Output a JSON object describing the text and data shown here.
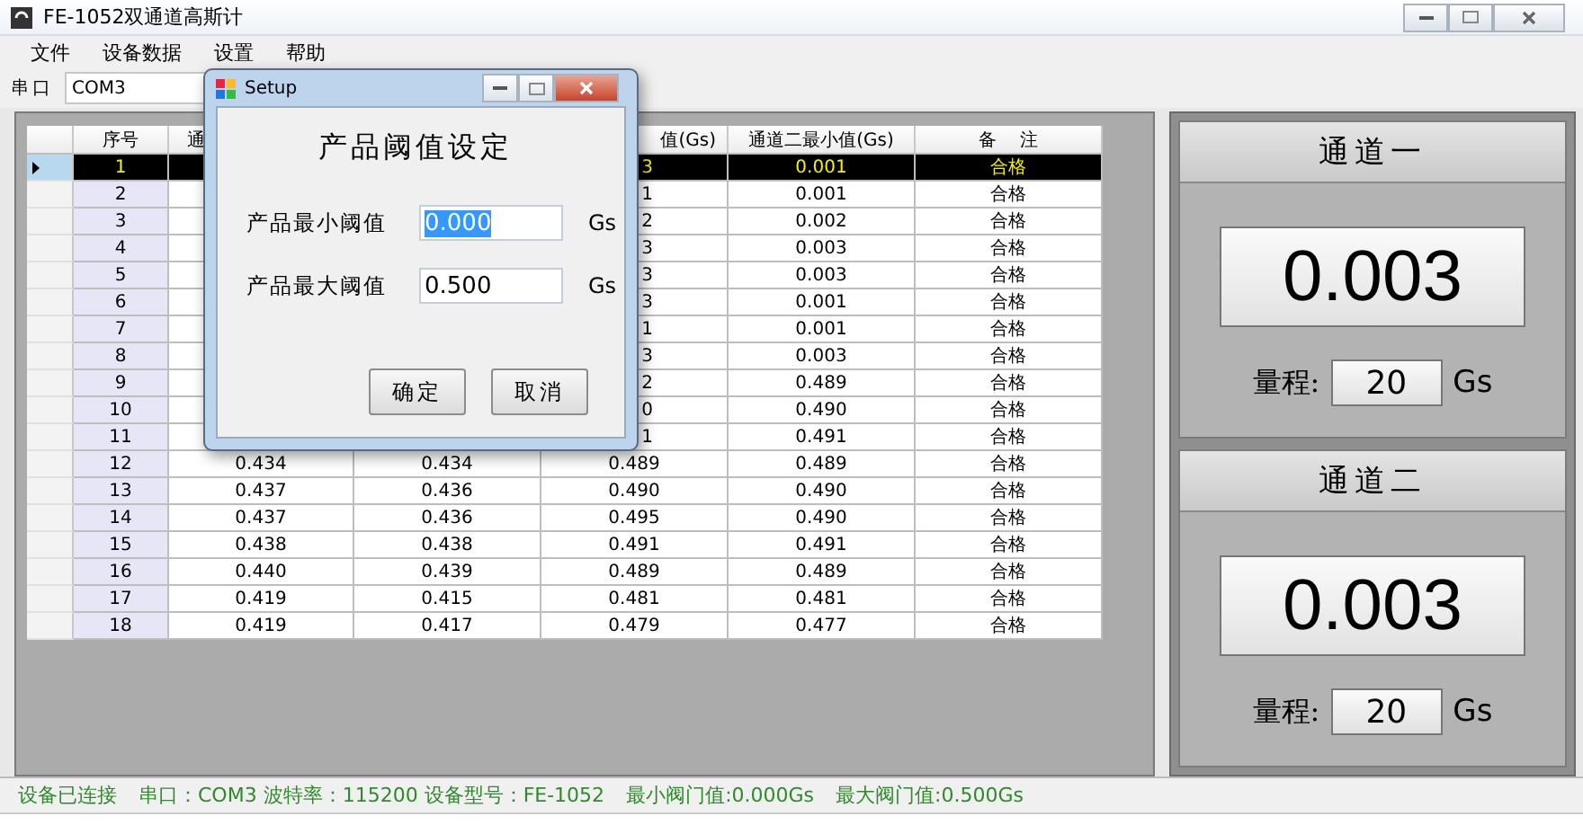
{
  "window": {
    "title": "FE-1052双通道高斯计"
  },
  "menu": [
    "文件",
    "设备数据",
    "设置",
    "帮助"
  ],
  "toolbar": {
    "port_label": "串口",
    "port_value": "COM3"
  },
  "table": {
    "columns": {
      "no": "序号",
      "column_2": "通",
      "column_4": "值(Gs)",
      "ch2_min": "通道二最小值(Gs)",
      "note": "备 注"
    },
    "rows": [
      {
        "selected": true,
        "no": "1",
        "column_4": "3",
        "ch2_min": "0.001",
        "note": "合格"
      },
      {
        "selected": false,
        "no": "2",
        "column_4": "1",
        "ch2_min": "0.001",
        "note": "合格"
      },
      {
        "selected": false,
        "no": "3",
        "column_4": "2",
        "ch2_min": "0.002",
        "note": "合格"
      },
      {
        "selected": false,
        "no": "4",
        "column_4": "3",
        "ch2_min": "0.003",
        "note": "合格"
      },
      {
        "selected": false,
        "no": "5",
        "column_4": "3",
        "ch2_min": "0.003",
        "note": "合格"
      },
      {
        "selected": false,
        "no": "6",
        "column_4": "3",
        "ch2_min": "0.001",
        "note": "合格"
      },
      {
        "selected": false,
        "no": "7",
        "column_4": "1",
        "ch2_min": "0.001",
        "note": "合格"
      },
      {
        "selected": false,
        "no": "8",
        "column_4": "3",
        "ch2_min": "0.003",
        "note": "合格"
      },
      {
        "selected": false,
        "no": "9",
        "column_4": "2",
        "ch2_min": "0.489",
        "note": "合格"
      },
      {
        "selected": false,
        "no": "10",
        "column_4": "0",
        "ch2_min": "0.490",
        "note": "合格"
      },
      {
        "selected": false,
        "no": "11",
        "column_4": "1",
        "ch2_min": "0.491",
        "note": "合格"
      },
      {
        "selected": false,
        "no": "12",
        "column_2": "0.434",
        "column_3": "0.434",
        "column_4": "0.489",
        "ch2_min": "0.489",
        "note": "合格"
      },
      {
        "selected": false,
        "no": "13",
        "column_2": "0.437",
        "column_3": "0.436",
        "column_4": "0.490",
        "ch2_min": "0.490",
        "note": "合格"
      },
      {
        "selected": false,
        "no": "14",
        "column_2": "0.437",
        "column_3": "0.436",
        "column_4": "0.495",
        "ch2_min": "0.490",
        "note": "合格"
      },
      {
        "selected": false,
        "no": "15",
        "column_2": "0.438",
        "column_3": "0.438",
        "column_4": "0.491",
        "ch2_min": "0.491",
        "note": "合格"
      },
      {
        "selected": false,
        "no": "16",
        "column_2": "0.440",
        "column_3": "0.439",
        "column_4": "0.489",
        "ch2_min": "0.489",
        "note": "合格"
      },
      {
        "selected": false,
        "no": "17",
        "column_2": "0.419",
        "column_3": "0.415",
        "column_4": "0.481",
        "ch2_min": "0.481",
        "note": "合格"
      },
      {
        "selected": false,
        "no": "18",
        "column_2": "0.419",
        "column_3": "0.417",
        "column_4": "0.479",
        "ch2_min": "0.477",
        "note": "合格"
      }
    ]
  },
  "channels": [
    {
      "title": "通道一",
      "value": "0.003",
      "range_label": "量程:",
      "range": "20",
      "unit": "Gs"
    },
    {
      "title": "通道二",
      "value": "0.003",
      "range_label": "量程:",
      "range": "20",
      "unit": "Gs"
    }
  ],
  "status_bar": [
    "设备已连接",
    "串口：COM3 波特率：115200 设备型号：FE-1052",
    "最小阀门值:0.000Gs",
    "最大阀门值:0.500Gs"
  ],
  "dialog": {
    "title": "Setup",
    "heading": "产品阈值设定",
    "fields": [
      {
        "label": "产品最小阈值",
        "value": "0.000",
        "unit": "Gs",
        "selected": true
      },
      {
        "label": "产品最大阈值",
        "value": "0.500",
        "unit": "Gs",
        "selected": false
      }
    ],
    "buttons": [
      "确定",
      "取消"
    ]
  }
}
